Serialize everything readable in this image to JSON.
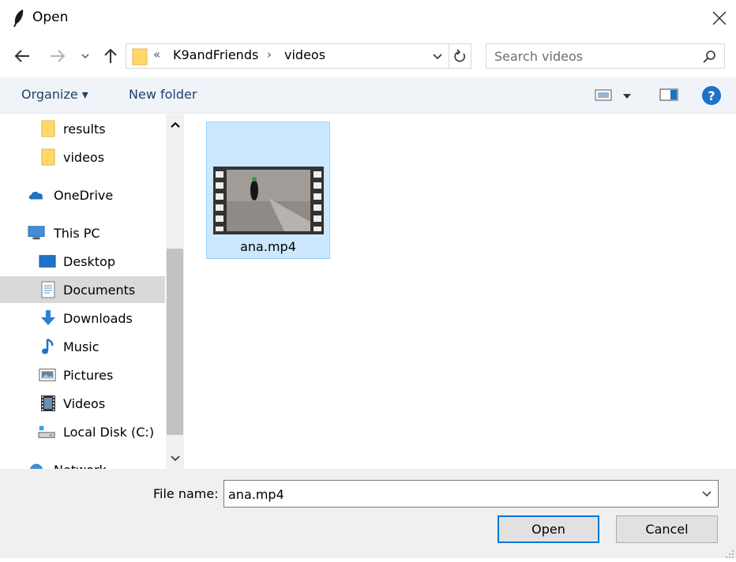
{
  "window": {
    "title": "Open"
  },
  "address": {
    "overflow_chevron": "«",
    "crumbs": [
      "K9andFriends",
      "videos"
    ],
    "separator": "›"
  },
  "search": {
    "placeholder": "Search videos"
  },
  "toolbar": {
    "organize_label": "Organize ▾",
    "new_folder_label": "New folder"
  },
  "sidebar": {
    "items": [
      {
        "label": "results",
        "icon": "folder-icon"
      },
      {
        "label": "videos",
        "icon": "folder-icon"
      },
      {
        "label": "OneDrive",
        "icon": "onedrive-icon"
      },
      {
        "label": "This PC",
        "icon": "computer-icon"
      },
      {
        "label": "Desktop",
        "icon": "desktop-icon"
      },
      {
        "label": "Documents",
        "icon": "documents-icon",
        "selected": true
      },
      {
        "label": "Downloads",
        "icon": "downloads-icon"
      },
      {
        "label": "Music",
        "icon": "music-icon"
      },
      {
        "label": "Pictures",
        "icon": "pictures-icon"
      },
      {
        "label": "Videos",
        "icon": "videos-icon"
      },
      {
        "label": "Local Disk (C:)",
        "icon": "drive-icon"
      },
      {
        "label": "Network",
        "icon": "network-icon"
      }
    ]
  },
  "files": [
    {
      "name": "ana.mp4",
      "type": "video",
      "selected": true
    }
  ],
  "footer": {
    "file_name_label": "File name:",
    "file_name_value": "ana.mp4",
    "open_label": "Open",
    "cancel_label": "Cancel"
  },
  "colors": {
    "accent": "#0078d7",
    "selection": "#cce8ff",
    "toolbar_bg": "#f0f4f9",
    "panel_bg": "#f0f0f0",
    "folder": "#ffd868",
    "help": "#1e73c8"
  }
}
